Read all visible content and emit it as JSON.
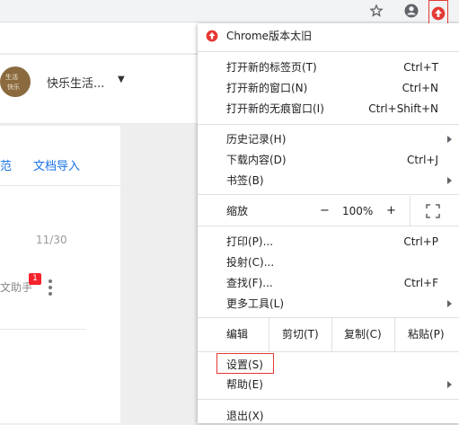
{
  "toolbar": {
    "icons": [
      "star-icon",
      "account-icon",
      "update-icon"
    ]
  },
  "page": {
    "account_name": "快乐生活...",
    "avatar_text": [
      "生活",
      "快乐"
    ],
    "tabs": [
      "范",
      "文档导入"
    ],
    "count": "11/30",
    "assistant_text": "文助手",
    "badge": "1"
  },
  "menu": {
    "update": "Chrome版本太旧",
    "new_tab": "打开新的标签页(T)",
    "new_tab_sc": "Ctrl+T",
    "new_window": "打开新的窗口(N)",
    "new_window_sc": "Ctrl+N",
    "incognito": "打开新的无痕窗口(I)",
    "incognito_sc": "Ctrl+Shift+N",
    "history": "历史记录(H)",
    "downloads": "下载内容(D)",
    "downloads_sc": "Ctrl+J",
    "bookmarks": "书签(B)",
    "zoom": "缩放",
    "zoom_minus": "−",
    "zoom_value": "100%",
    "zoom_plus": "+",
    "print": "打印(P)...",
    "print_sc": "Ctrl+P",
    "cast": "投射(C)...",
    "find": "查找(F)...",
    "find_sc": "Ctrl+F",
    "more_tools": "更多工具(L)",
    "edit": "编辑",
    "cut": "剪切(T)",
    "copy": "复制(C)",
    "paste": "粘贴(P)",
    "settings": "设置(S)",
    "help": "帮助(E)",
    "exit": "退出(X)"
  },
  "colors": {
    "accent_red": "#e53935",
    "link_blue": "#1a73e8"
  }
}
